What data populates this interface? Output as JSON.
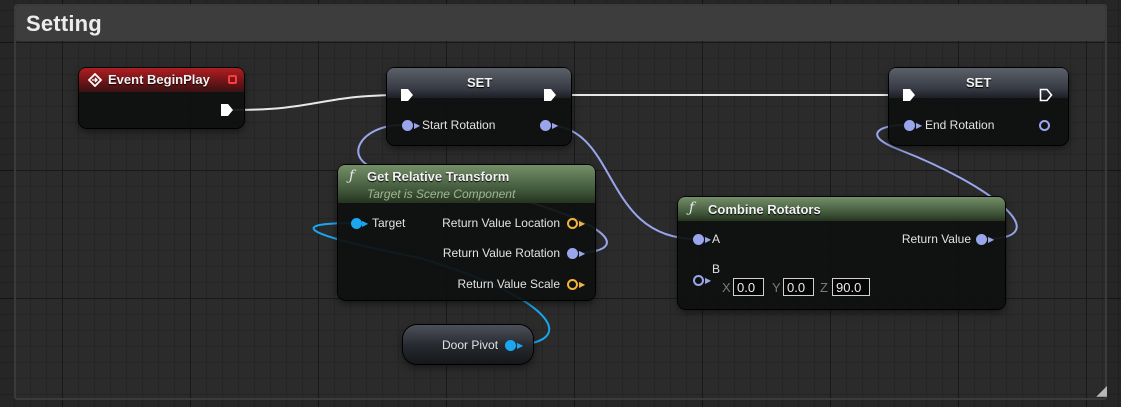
{
  "comment": {
    "title": "Setting"
  },
  "nodes": {
    "event_begin_play": {
      "title": "Event BeginPlay"
    },
    "set_start": {
      "title": "SET",
      "pin": "Start Rotation"
    },
    "set_end": {
      "title": "SET",
      "pin": "End Rotation"
    },
    "get_relative_transform": {
      "title": "Get Relative Transform",
      "subtitle": "Target is Scene Component",
      "target": "Target",
      "location": "Return Value Location",
      "rotation": "Return Value Rotation",
      "scale": "Return Value Scale"
    },
    "combine_rotators": {
      "title": "Combine Rotators",
      "a": "A",
      "b": "B",
      "return_value": "Return Value",
      "x_label": "X",
      "x_value": "0.0",
      "y_label": "Y",
      "y_value": "0.0",
      "z_label": "Z",
      "z_value": "90.0"
    },
    "door_pivot": {
      "label": "Door Pivot"
    }
  },
  "colors": {
    "exec_wire": "#e8e8e8",
    "rotator_wire": "#9aa6ec",
    "object_wire": "#1aa6f0",
    "event_header": "#b01e22",
    "function_header": "#5c7a52",
    "struct_pin": "#f2b43a"
  }
}
